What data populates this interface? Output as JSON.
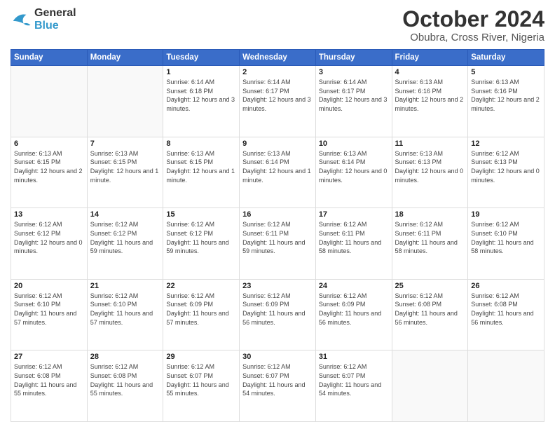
{
  "header": {
    "logo_general": "General",
    "logo_blue": "Blue",
    "month_title": "October 2024",
    "location": "Obubra, Cross River, Nigeria"
  },
  "days_of_week": [
    "Sunday",
    "Monday",
    "Tuesday",
    "Wednesday",
    "Thursday",
    "Friday",
    "Saturday"
  ],
  "weeks": [
    [
      {
        "day": "",
        "info": ""
      },
      {
        "day": "",
        "info": ""
      },
      {
        "day": "1",
        "info": "Sunrise: 6:14 AM\nSunset: 6:18 PM\nDaylight: 12 hours and 3 minutes."
      },
      {
        "day": "2",
        "info": "Sunrise: 6:14 AM\nSunset: 6:17 PM\nDaylight: 12 hours and 3 minutes."
      },
      {
        "day": "3",
        "info": "Sunrise: 6:14 AM\nSunset: 6:17 PM\nDaylight: 12 hours and 3 minutes."
      },
      {
        "day": "4",
        "info": "Sunrise: 6:13 AM\nSunset: 6:16 PM\nDaylight: 12 hours and 2 minutes."
      },
      {
        "day": "5",
        "info": "Sunrise: 6:13 AM\nSunset: 6:16 PM\nDaylight: 12 hours and 2 minutes."
      }
    ],
    [
      {
        "day": "6",
        "info": "Sunrise: 6:13 AM\nSunset: 6:15 PM\nDaylight: 12 hours and 2 minutes."
      },
      {
        "day": "7",
        "info": "Sunrise: 6:13 AM\nSunset: 6:15 PM\nDaylight: 12 hours and 1 minute."
      },
      {
        "day": "8",
        "info": "Sunrise: 6:13 AM\nSunset: 6:15 PM\nDaylight: 12 hours and 1 minute."
      },
      {
        "day": "9",
        "info": "Sunrise: 6:13 AM\nSunset: 6:14 PM\nDaylight: 12 hours and 1 minute."
      },
      {
        "day": "10",
        "info": "Sunrise: 6:13 AM\nSunset: 6:14 PM\nDaylight: 12 hours and 0 minutes."
      },
      {
        "day": "11",
        "info": "Sunrise: 6:13 AM\nSunset: 6:13 PM\nDaylight: 12 hours and 0 minutes."
      },
      {
        "day": "12",
        "info": "Sunrise: 6:12 AM\nSunset: 6:13 PM\nDaylight: 12 hours and 0 minutes."
      }
    ],
    [
      {
        "day": "13",
        "info": "Sunrise: 6:12 AM\nSunset: 6:12 PM\nDaylight: 12 hours and 0 minutes."
      },
      {
        "day": "14",
        "info": "Sunrise: 6:12 AM\nSunset: 6:12 PM\nDaylight: 11 hours and 59 minutes."
      },
      {
        "day": "15",
        "info": "Sunrise: 6:12 AM\nSunset: 6:12 PM\nDaylight: 11 hours and 59 minutes."
      },
      {
        "day": "16",
        "info": "Sunrise: 6:12 AM\nSunset: 6:11 PM\nDaylight: 11 hours and 59 minutes."
      },
      {
        "day": "17",
        "info": "Sunrise: 6:12 AM\nSunset: 6:11 PM\nDaylight: 11 hours and 58 minutes."
      },
      {
        "day": "18",
        "info": "Sunrise: 6:12 AM\nSunset: 6:11 PM\nDaylight: 11 hours and 58 minutes."
      },
      {
        "day": "19",
        "info": "Sunrise: 6:12 AM\nSunset: 6:10 PM\nDaylight: 11 hours and 58 minutes."
      }
    ],
    [
      {
        "day": "20",
        "info": "Sunrise: 6:12 AM\nSunset: 6:10 PM\nDaylight: 11 hours and 57 minutes."
      },
      {
        "day": "21",
        "info": "Sunrise: 6:12 AM\nSunset: 6:10 PM\nDaylight: 11 hours and 57 minutes."
      },
      {
        "day": "22",
        "info": "Sunrise: 6:12 AM\nSunset: 6:09 PM\nDaylight: 11 hours and 57 minutes."
      },
      {
        "day": "23",
        "info": "Sunrise: 6:12 AM\nSunset: 6:09 PM\nDaylight: 11 hours and 56 minutes."
      },
      {
        "day": "24",
        "info": "Sunrise: 6:12 AM\nSunset: 6:09 PM\nDaylight: 11 hours and 56 minutes."
      },
      {
        "day": "25",
        "info": "Sunrise: 6:12 AM\nSunset: 6:08 PM\nDaylight: 11 hours and 56 minutes."
      },
      {
        "day": "26",
        "info": "Sunrise: 6:12 AM\nSunset: 6:08 PM\nDaylight: 11 hours and 56 minutes."
      }
    ],
    [
      {
        "day": "27",
        "info": "Sunrise: 6:12 AM\nSunset: 6:08 PM\nDaylight: 11 hours and 55 minutes."
      },
      {
        "day": "28",
        "info": "Sunrise: 6:12 AM\nSunset: 6:08 PM\nDaylight: 11 hours and 55 minutes."
      },
      {
        "day": "29",
        "info": "Sunrise: 6:12 AM\nSunset: 6:07 PM\nDaylight: 11 hours and 55 minutes."
      },
      {
        "day": "30",
        "info": "Sunrise: 6:12 AM\nSunset: 6:07 PM\nDaylight: 11 hours and 54 minutes."
      },
      {
        "day": "31",
        "info": "Sunrise: 6:12 AM\nSunset: 6:07 PM\nDaylight: 11 hours and 54 minutes."
      },
      {
        "day": "",
        "info": ""
      },
      {
        "day": "",
        "info": ""
      }
    ]
  ]
}
